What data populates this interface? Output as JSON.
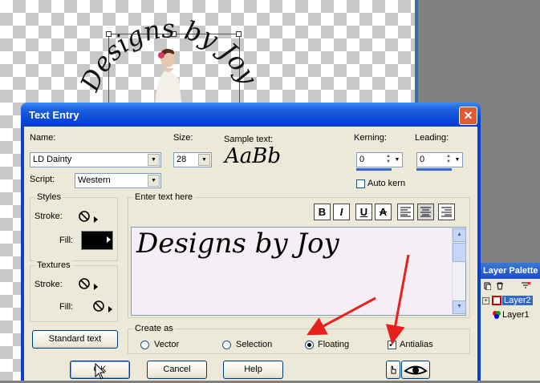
{
  "canvas": {
    "artwork_text": "Designs by Joy"
  },
  "layer_palette": {
    "title": "Layer Palette",
    "layers": [
      {
        "label": "Layer2",
        "selected": true
      },
      {
        "label": "Layer1",
        "selected": false
      }
    ]
  },
  "dialog": {
    "title": "Text Entry",
    "name_label": "Name:",
    "name_value": "LD Dainty",
    "script_label": "Script:",
    "script_value": "Western",
    "size_label": "Size:",
    "size_value": "28",
    "sample_label": "Sample text:",
    "sample_text": "AaBb",
    "kerning_label": "Kerning:",
    "kerning_value": "0",
    "leading_label": "Leading:",
    "leading_value": "0",
    "auto_kern_label": "Auto kern",
    "styles_title": "Styles",
    "stroke_label": "Stroke:",
    "fill_label": "Fill:",
    "textures_title": "Textures",
    "enter_text_title": "Enter text here",
    "entered_text": "Designs by Joy",
    "format_buttons": [
      "B",
      "I",
      "U",
      "A"
    ],
    "standard_text_button": "Standard text",
    "create_as_title": "Create as",
    "create_options": [
      {
        "label": "Vector",
        "selected": false
      },
      {
        "label": "Selection",
        "selected": false
      },
      {
        "label": "Floating",
        "selected": true
      }
    ],
    "antialias_label": "Antialias",
    "antialias_checked": true,
    "ok_button": "OK",
    "cancel_button": "Cancel",
    "help_button": "Help"
  },
  "colors": {
    "annotation_arrow": "#e8201c",
    "title_bar": "#0a48d6",
    "fill_swatch": "#000000"
  }
}
